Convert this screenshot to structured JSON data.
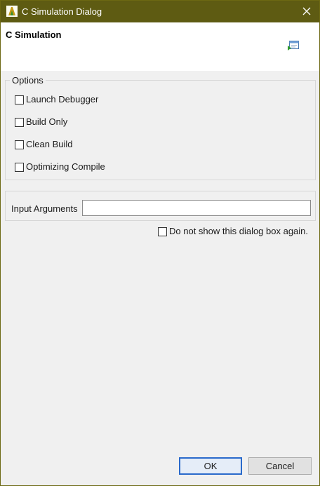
{
  "window": {
    "title": "C Simulation Dialog",
    "title_bar_color": "#5e5b12"
  },
  "header": {
    "heading": "C Simulation",
    "icon": "run-simulation-icon"
  },
  "options": {
    "legend": "Options",
    "items": [
      {
        "label": "Launch Debugger",
        "checked": false
      },
      {
        "label": "Build Only",
        "checked": false
      },
      {
        "label": "Clean Build",
        "checked": false
      },
      {
        "label": "Optimizing Compile",
        "checked": false
      }
    ]
  },
  "input_arguments": {
    "label": "Input Arguments",
    "value": ""
  },
  "dont_show_again": {
    "label": "Do not show this dialog box again.",
    "checked": false
  },
  "buttons": {
    "ok": "OK",
    "cancel": "Cancel"
  },
  "colors": {
    "accent": "#2a6acb",
    "header_bg": "#ffffff",
    "dialog_bg": "#f0f0f0"
  }
}
